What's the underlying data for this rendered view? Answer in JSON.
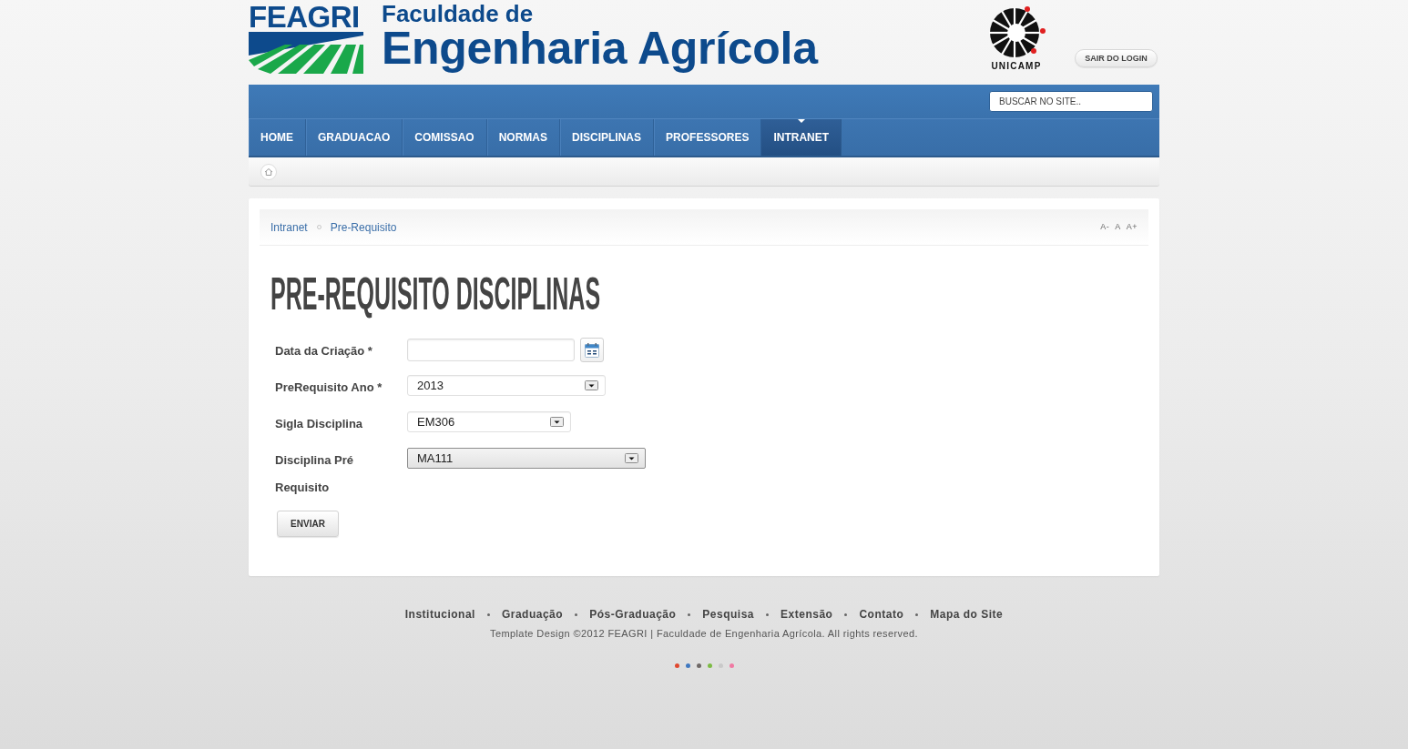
{
  "header": {
    "logo_wordmark": "FEAGRI",
    "title_line_1": "Faculdade de",
    "title_line_2": "Engenharia Agrícola",
    "university_name": "UNICAMP",
    "logout_button": "SAIR DO LOGIN"
  },
  "navbar": {
    "search": {
      "placeholder": "BUSCAR NO SITE.."
    },
    "items": [
      {
        "label": "HOME",
        "selected": false
      },
      {
        "label": "GRADUACAO",
        "selected": false
      },
      {
        "label": "COMISSAO",
        "selected": false
      },
      {
        "label": "NORMAS",
        "selected": false
      },
      {
        "label": "DISCIPLINAS",
        "selected": false
      },
      {
        "label": "PROFESSORES",
        "selected": false
      },
      {
        "label": "INTRANET",
        "selected": true
      }
    ]
  },
  "breadcrumb": {
    "items": [
      "Intranet",
      "Pre-Requisito"
    ],
    "font_size_controls": [
      "A-",
      "A",
      "A+"
    ]
  },
  "page_title": "PRE-REQUISITO DISCIPLINAS",
  "form": {
    "fields": [
      {
        "kind": "date",
        "label": "Data da Criação *",
        "focused": false
      },
      {
        "kind": "select",
        "label": "PreRequisito Ano *",
        "value": "2013",
        "focused": false
      },
      {
        "kind": "select",
        "label": "Sigla Disciplina",
        "value": "EM306",
        "focused": false
      },
      {
        "kind": "select",
        "label": "Disciplina Pré Requisito",
        "value": "MA111",
        "focused": true
      }
    ],
    "submit_button": "ENVIAR"
  },
  "footer": {
    "links": [
      "Institucional",
      "Graduação",
      "Pós-Graduação",
      "Pesquisa",
      "Extensão",
      "Contato",
      "Mapa do Site"
    ],
    "copyright": "Template Design ©2012 FEAGRI | Faculdade de Engenharia Agrícola. All rights reserved.",
    "color_options": [
      {
        "color": "#e0482f"
      },
      {
        "color": "#3f78c0"
      },
      {
        "color": "#6e6866"
      },
      {
        "color": "#7dbb45"
      },
      {
        "color": "#c9c9c9"
      },
      {
        "color": "#f07aa3"
      }
    ]
  }
}
